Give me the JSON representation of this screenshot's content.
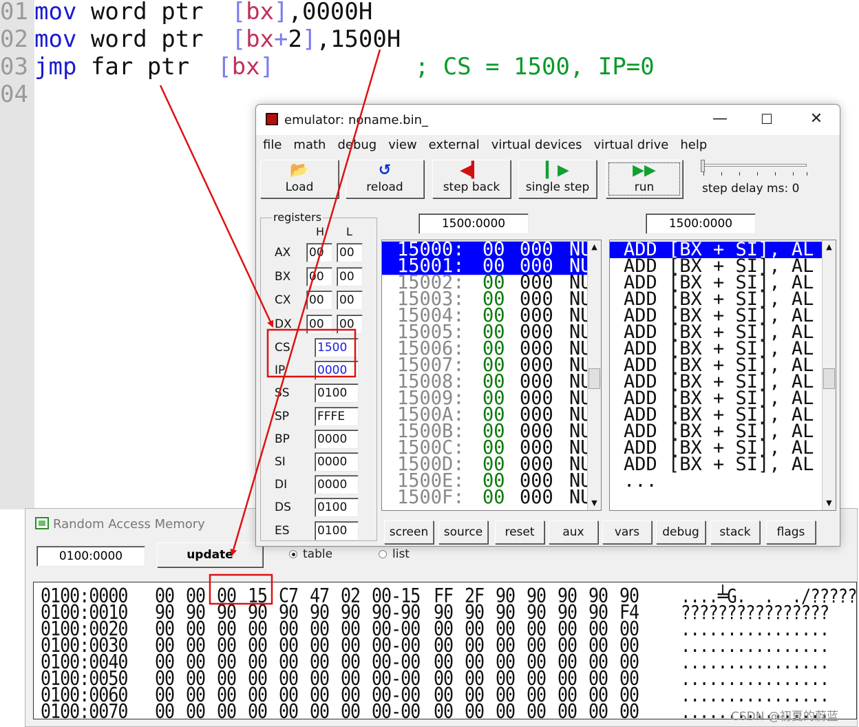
{
  "editor": {
    "lines": [
      {
        "num": "01",
        "tokens": [
          [
            "kw",
            "mov "
          ],
          [
            "tx",
            "word ptr  "
          ],
          [
            "br",
            "["
          ],
          [
            "rg",
            "bx"
          ],
          [
            "br",
            "]"
          ],
          [
            "tx",
            ",0000H"
          ]
        ]
      },
      {
        "num": "02",
        "tokens": [
          [
            "kw",
            "mov "
          ],
          [
            "tx",
            "word ptr  "
          ],
          [
            "br",
            "["
          ],
          [
            "rg",
            "bx"
          ],
          [
            "br",
            "+"
          ],
          [
            "tx",
            "2"
          ],
          [
            "br",
            "]"
          ],
          [
            "tx",
            ",1500H"
          ]
        ]
      },
      {
        "num": "03",
        "tokens": [
          [
            "kw",
            "jmp "
          ],
          [
            "tx",
            "far ptr  "
          ],
          [
            "br",
            "["
          ],
          [
            "rg",
            "bx"
          ],
          [
            "br",
            "]"
          ],
          [
            "tx",
            "          "
          ],
          [
            "cm",
            "; CS = 1500, IP=0"
          ]
        ]
      },
      {
        "num": "04",
        "tokens": []
      }
    ]
  },
  "emulator": {
    "title": "emulator: noname.bin_",
    "controls": {
      "minimize": "—",
      "maximize": "☐",
      "close": "✕"
    },
    "menu": [
      "file",
      "math",
      "debug",
      "view",
      "external",
      "virtual devices",
      "virtual drive",
      "help"
    ],
    "toolbar": {
      "load": "Load",
      "reload": "reload",
      "step_back": "step back",
      "single_step": "single step",
      "run": "run",
      "step_delay": "step delay ms: 0"
    },
    "registers": {
      "title": "registers",
      "h_label": "H",
      "l_label": "L",
      "split": [
        {
          "name": "AX",
          "h": "00",
          "l": "00"
        },
        {
          "name": "BX",
          "h": "00",
          "l": "00"
        },
        {
          "name": "CX",
          "h": "00",
          "l": "00"
        },
        {
          "name": "DX",
          "h": "00",
          "l": "00"
        }
      ],
      "full": [
        {
          "name": "CS",
          "value": "1500",
          "highlight": true
        },
        {
          "name": "IP",
          "value": "0000",
          "highlight": true
        },
        {
          "name": "SS",
          "value": "0100",
          "highlight": false
        },
        {
          "name": "SP",
          "value": "FFFE",
          "highlight": false
        },
        {
          "name": "BP",
          "value": "0000",
          "highlight": false
        },
        {
          "name": "SI",
          "value": "0000",
          "highlight": false
        },
        {
          "name": "DI",
          "value": "0000",
          "highlight": false
        },
        {
          "name": "DS",
          "value": "0100",
          "highlight": false
        },
        {
          "name": "ES",
          "value": "0100",
          "highlight": false
        }
      ]
    },
    "memory_address": "1500:0000",
    "disasm_address": "1500:0000",
    "memory_rows": [
      {
        "addr": "15000:",
        "hex": "00",
        "dec": "000",
        "ch": "NU",
        "selected": true
      },
      {
        "addr": "15001:",
        "hex": "00",
        "dec": "000",
        "ch": "NU",
        "selected": true
      },
      {
        "addr": "15002:",
        "hex": "00",
        "dec": "000",
        "ch": "NU",
        "selected": false
      },
      {
        "addr": "15003:",
        "hex": "00",
        "dec": "000",
        "ch": "NU",
        "selected": false
      },
      {
        "addr": "15004:",
        "hex": "00",
        "dec": "000",
        "ch": "NU",
        "selected": false
      },
      {
        "addr": "15005:",
        "hex": "00",
        "dec": "000",
        "ch": "NU",
        "selected": false
      },
      {
        "addr": "15006:",
        "hex": "00",
        "dec": "000",
        "ch": "NU",
        "selected": false
      },
      {
        "addr": "15007:",
        "hex": "00",
        "dec": "000",
        "ch": "NU",
        "selected": false
      },
      {
        "addr": "15008:",
        "hex": "00",
        "dec": "000",
        "ch": "NU",
        "selected": false
      },
      {
        "addr": "15009:",
        "hex": "00",
        "dec": "000",
        "ch": "NU",
        "selected": false
      },
      {
        "addr": "1500A:",
        "hex": "00",
        "dec": "000",
        "ch": "NU",
        "selected": false
      },
      {
        "addr": "1500B:",
        "hex": "00",
        "dec": "000",
        "ch": "NU",
        "selected": false
      },
      {
        "addr": "1500C:",
        "hex": "00",
        "dec": "000",
        "ch": "NU",
        "selected": false
      },
      {
        "addr": "1500D:",
        "hex": "00",
        "dec": "000",
        "ch": "NU",
        "selected": false
      },
      {
        "addr": "1500E:",
        "hex": "00",
        "dec": "000",
        "ch": "NU",
        "selected": false
      },
      {
        "addr": "1500F:",
        "hex": "00",
        "dec": "000",
        "ch": "NU",
        "selected": false
      }
    ],
    "disasm_rows": [
      {
        "text": "ADD [BX + SI], AL",
        "selected": true
      },
      {
        "text": "ADD [BX + SI], AL",
        "selected": false
      },
      {
        "text": "ADD [BX + SI], AL",
        "selected": false
      },
      {
        "text": "ADD [BX + SI], AL",
        "selected": false
      },
      {
        "text": "ADD [BX + SI], AL",
        "selected": false
      },
      {
        "text": "ADD [BX + SI], AL",
        "selected": false
      },
      {
        "text": "ADD [BX + SI], AL",
        "selected": false
      },
      {
        "text": "ADD [BX + SI], AL",
        "selected": false
      },
      {
        "text": "ADD [BX + SI], AL",
        "selected": false
      },
      {
        "text": "ADD [BX + SI], AL",
        "selected": false
      },
      {
        "text": "ADD [BX + SI], AL",
        "selected": false
      },
      {
        "text": "ADD [BX + SI], AL",
        "selected": false
      },
      {
        "text": "ADD [BX + SI], AL",
        "selected": false
      },
      {
        "text": "ADD [BX + SI], AL",
        "selected": false
      },
      {
        "text": "...",
        "selected": false
      }
    ],
    "tabs": [
      "screen",
      "source",
      "reset",
      "aux",
      "vars",
      "debug",
      "stack",
      "flags"
    ]
  },
  "ram": {
    "title": "Random Access Memory",
    "address": "0100:0000",
    "update": "update",
    "view_table": "table",
    "view_list": "list",
    "rows": [
      {
        "addr": "0100:0000",
        "bytes": [
          "00",
          "00",
          "00",
          "15",
          "C7",
          "47",
          "02",
          "00-15",
          "FF",
          "2F",
          "90",
          "90",
          "90",
          "90",
          "90"
        ],
        "ascii": "....╧G.  .  ./?????"
      },
      {
        "addr": "0100:0010",
        "bytes": [
          "90",
          "90",
          "90",
          "90",
          "90",
          "90",
          "90",
          "90-90",
          "90",
          "90",
          "90",
          "90",
          "90",
          "90",
          "F4"
        ],
        "ascii": "????????????????"
      },
      {
        "addr": "0100:0020",
        "bytes": [
          "00",
          "00",
          "00",
          "00",
          "00",
          "00",
          "00",
          "00-00",
          "00",
          "00",
          "00",
          "00",
          "00",
          "00",
          "00"
        ],
        "ascii": "................"
      },
      {
        "addr": "0100:0030",
        "bytes": [
          "00",
          "00",
          "00",
          "00",
          "00",
          "00",
          "00",
          "00-00",
          "00",
          "00",
          "00",
          "00",
          "00",
          "00",
          "00"
        ],
        "ascii": "................"
      },
      {
        "addr": "0100:0040",
        "bytes": [
          "00",
          "00",
          "00",
          "00",
          "00",
          "00",
          "00",
          "00-00",
          "00",
          "00",
          "00",
          "00",
          "00",
          "00",
          "00"
        ],
        "ascii": "................"
      },
      {
        "addr": "0100:0050",
        "bytes": [
          "00",
          "00",
          "00",
          "00",
          "00",
          "00",
          "00",
          "00-00",
          "00",
          "00",
          "00",
          "00",
          "00",
          "00",
          "00"
        ],
        "ascii": "................"
      },
      {
        "addr": "0100:0060",
        "bytes": [
          "00",
          "00",
          "00",
          "00",
          "00",
          "00",
          "00",
          "00-00",
          "00",
          "00",
          "00",
          "00",
          "00",
          "00",
          "00"
        ],
        "ascii": "................"
      },
      {
        "addr": "0100:0070",
        "bytes": [
          "00",
          "00",
          "00",
          "00",
          "00",
          "00",
          "00",
          "00-00",
          "00",
          "00",
          "00",
          "00",
          "00",
          "00",
          "00"
        ],
        "ascii": "................"
      }
    ]
  },
  "watermark": "CSDN @初夏的蔚蓝",
  "colors": {
    "annotation": "#e01010",
    "selection": "#0000ff",
    "register_highlight": "#1a1ae0"
  }
}
